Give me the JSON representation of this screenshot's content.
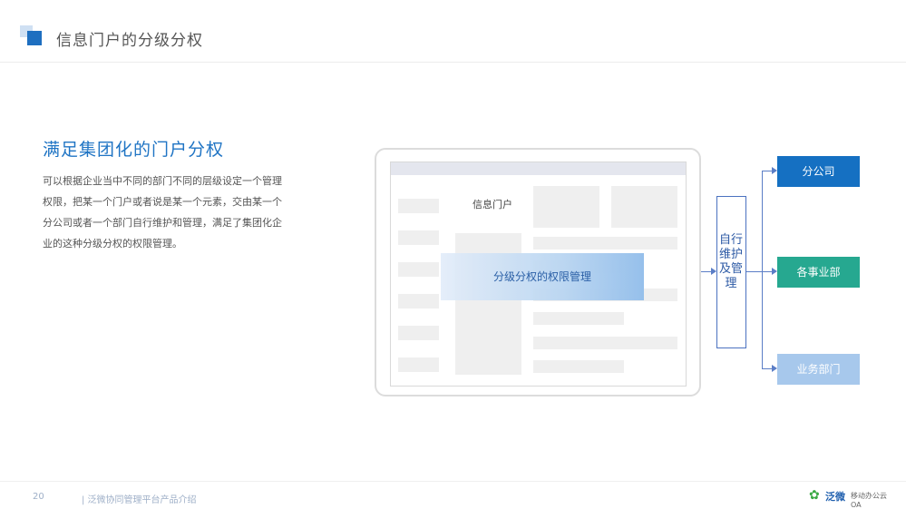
{
  "header": {
    "title": "信息门户的分级分权"
  },
  "content": {
    "subtitle": "满足集团化的门户分权",
    "description": "可以根据企业当中不同的部门不同的层级设定一个管理权限，把某一个门户或者说是某一个元素，交由某一个分公司或者一个部门自行维护和管理，满足了集团化企业的这种分级分权的权限管理。"
  },
  "diagram": {
    "portal_label": "信息门户",
    "overlay_label": "分级分权的权限管理",
    "middle_box": "自行维护及管理",
    "targets": [
      "分公司",
      "各事业部",
      "业务部门"
    ]
  },
  "footer": {
    "page_number": "20",
    "text": "| 泛微协同管理平台产品介绍",
    "logo_name": "泛微",
    "logo_slogan": "移动办公云OA"
  },
  "colors": {
    "accent": "#1f74c4",
    "target_1": "#1570c2",
    "target_2": "#26a890",
    "target_3": "#a7c8ec"
  }
}
